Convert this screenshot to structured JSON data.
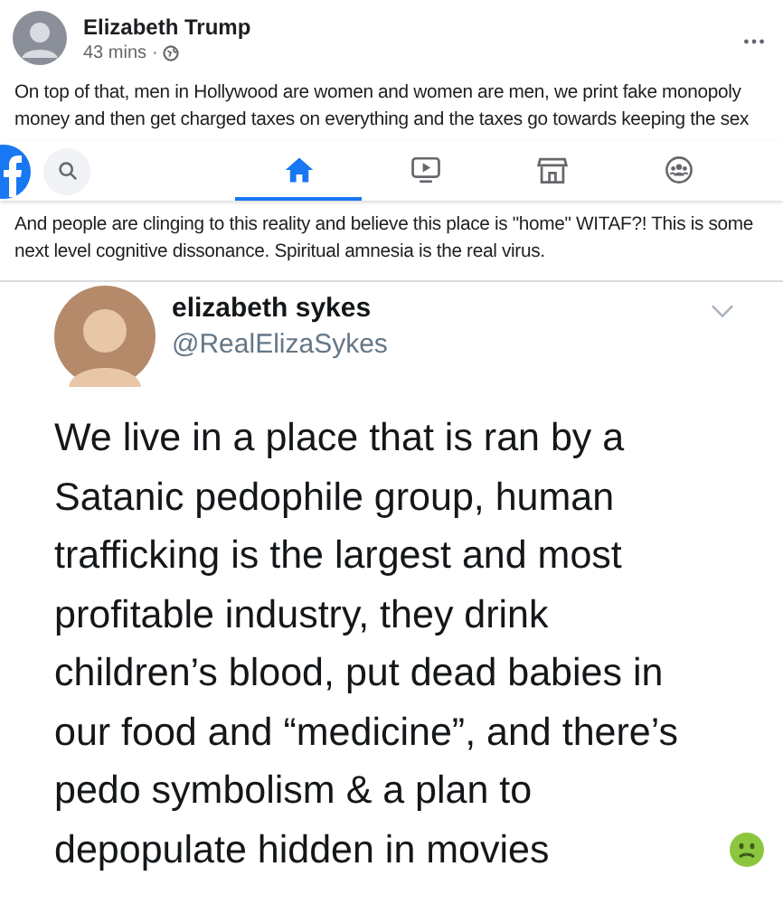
{
  "post": {
    "author": "Elizabeth Trump",
    "time": "43 mins",
    "separator": "·",
    "text": "On top of that, men in Hollywood are women and women are men, we print fake monopoly money and then get charged taxes on everything and the taxes go towards keeping the sex",
    "text_continued": "And people are clinging to this reality and believe this place is \"home\" WITAF?! This is some next level cognitive dissonance. Spiritual amnesia is the real virus."
  },
  "nav": {
    "tabs": [
      {
        "kind": "home",
        "selected": true
      },
      {
        "kind": "video",
        "selected": false
      },
      {
        "kind": "marketplace",
        "selected": false
      },
      {
        "kind": "groups",
        "selected": false
      }
    ]
  },
  "tweet": {
    "name": "elizabeth sykes",
    "handle": "@RealElizaSykes",
    "text": "We live in a place that is ran by a Satanic pedophile group, human trafficking is the largest and most profitable industry, they drink children’s blood, put dead babies in our food and “medicine”, and there’s pedo symbolism & a plan to depopulate hidden in movies"
  }
}
